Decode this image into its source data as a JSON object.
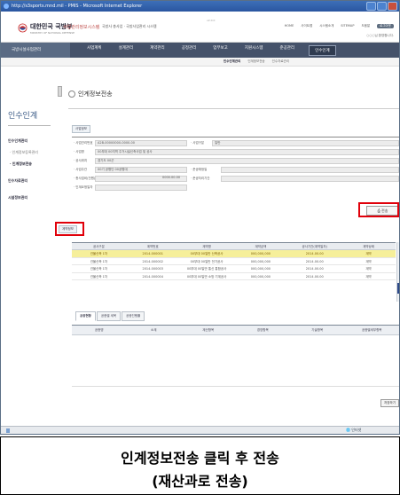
{
  "browser": {
    "title": "http://s3sports.mnd.mil - PMIS - Microsoft Internet Explorer"
  },
  "header": {
    "logo_text": "대한민국 국방부",
    "logo_sub": "MINISTRY OF NATIONAL DEFENSE",
    "system_name": "사업관리정보시스템",
    "system_desc": "국방사 총사업 · 국방사업관리 시스템",
    "version": "v2.0.0",
    "util_links": [
      "HOME",
      "사이트맵",
      "시스템소개",
      "SITEMAP",
      "도움말",
      "로그아웃"
    ],
    "welcome": "○○○님 환영합니다."
  },
  "nav": {
    "brand": "국방시설사업관리",
    "items": [
      "사업계획",
      "설계관리",
      "계약관리",
      "공정관리",
      "업무보고",
      "지원시스템",
      "준공관리",
      "인수인계"
    ],
    "active": "인수인계",
    "sub_items": [
      "인수인계관리",
      "인계정보전송",
      "인수자료관리"
    ],
    "sub_active": "인수인계관리"
  },
  "left": {
    "title": "인수인계",
    "menu": [
      {
        "label": "인수인계관리",
        "type": "grp"
      },
      {
        "label": "· 인계정보등록관리",
        "type": "sub"
      },
      {
        "label": "· 인계정보전송",
        "type": "sub on"
      },
      {
        "label": "인수자료관리",
        "type": "grp"
      },
      {
        "label": "시설정보관리",
        "type": "grp"
      }
    ]
  },
  "page": {
    "title": "인계정보전송",
    "section_chip": "사업정보",
    "form": [
      {
        "label": "· 사업관리번호",
        "value": "A2B-00000000-0000-00",
        "label2": "· 사업구분",
        "value2": "일반"
      },
      {
        "label": "· 사업명",
        "value": "00부대 00지역 주거시설신축사업 및 공사"
      },
      {
        "label": "· 공사위치",
        "value": "경기도 00군"
      },
      {
        "label": "· 사업주관",
        "value": "00기 공병단 00공병대",
        "label2": "· 준공예정일",
        "value2": ""
      },
      {
        "label": "· 총사업비(천원)",
        "value": "",
        "value_mid": "0000.00.00",
        "label2": "· 준공처리기간",
        "value2": ""
      },
      {
        "label": "· 인계요청일자",
        "value": ""
      }
    ],
    "transfer_button": "전송",
    "tab_chip": "계약정보",
    "grid1_columns": [
      "공사구분",
      "계약번호",
      "계약명",
      "계약금액",
      "공사기간(계약일자)",
      "계약상태"
    ],
    "grid1_rows": [
      [
        "건물신축 1차",
        "2014-000001",
        "00부대 00일반 신축공사",
        "000,000,000",
        "2014.00.00",
        "계약"
      ],
      [
        "건물신축 1차",
        "2014-000002",
        "00부대 00일반 전기공사",
        "000,000,000",
        "2014.00.00",
        "계약"
      ],
      [
        "건물신축 1차",
        "2014-000003",
        "00부대 00일반 통신 통합공사",
        "000,000,000",
        "2014.00.00",
        "계약"
      ],
      [
        "건물신축 1차",
        "2014-000004",
        "00부대 00일반 소방 기계공사",
        "000,000,000",
        "2014.00.00",
        "계약"
      ]
    ],
    "grid1_selected_index": 0,
    "tabs2": [
      "공종현황",
      "공종별 세목",
      "공종진행률"
    ],
    "tabs2_active": 0,
    "grid2_columns": [
      "공종명",
      "소계",
      "계산항목",
      "경영항목",
      "기술항목",
      "공종별세부항목"
    ],
    "grid2_button": "저장하기"
  },
  "statusbar": {
    "zone": "인터넷"
  },
  "caption": {
    "line1": "인계정보전송 클릭 후 전송",
    "line2": "(재산과로 전송)"
  },
  "colors": {
    "nav_bg": "#45526a",
    "highlight": "#e0000a",
    "selected_row": "#f6ef9a",
    "title_bar": "#2a56a0"
  }
}
